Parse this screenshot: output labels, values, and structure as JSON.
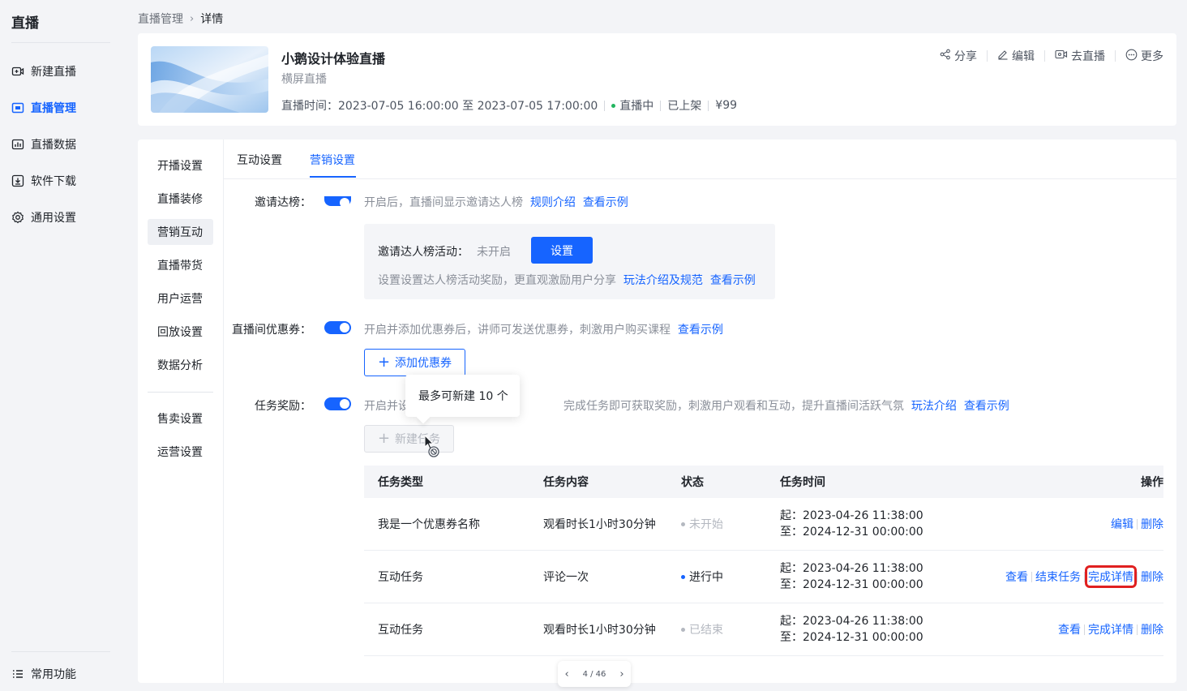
{
  "sidebar": {
    "brand": "直播",
    "items": [
      {
        "label": "新建直播",
        "icon": "video-add-icon"
      },
      {
        "label": "直播管理",
        "icon": "live-manage-icon"
      },
      {
        "label": "直播数据",
        "icon": "data-chart-icon"
      },
      {
        "label": "软件下载",
        "icon": "download-icon"
      },
      {
        "label": "通用设置",
        "icon": "gear-icon"
      }
    ],
    "bottom": {
      "label": "常用功能",
      "icon": "menu-list-icon"
    }
  },
  "breadcrumb": {
    "parent": "直播管理",
    "current": "详情"
  },
  "header": {
    "title": "小鹅设计体验直播",
    "subtitle": "横屏直播",
    "time_label": "直播时间：2023-07-05 16:00:00 至 2023-07-05 17:00:00",
    "status": "直播中",
    "shelf": "已上架",
    "price": "¥99",
    "actions": {
      "share": "分享",
      "edit": "编辑",
      "go_live": "去直播",
      "more": "更多"
    }
  },
  "subnav": {
    "items": [
      "开播设置",
      "直播装修",
      "营销互动",
      "直播带货",
      "用户运营",
      "回放设置",
      "数据分析"
    ],
    "items2": [
      "售卖设置",
      "运营设置"
    ]
  },
  "tabs": [
    "互动设置",
    "营销设置"
  ],
  "invite": {
    "label": "邀请达榜：",
    "desc": "开启后，直播间显示邀请达人榜",
    "link1": "规则介绍",
    "link2": "查看示例",
    "box_label": "邀请达人榜活动：",
    "box_status": "未开启",
    "box_button": "设置",
    "box_desc": "设置设置达人榜活动奖励，更直观激励用户分享",
    "box_link1": "玩法介绍及规范",
    "box_link2": "查看示例"
  },
  "coupon": {
    "label": "直播间优惠券：",
    "desc": "开启并添加优惠券后，讲师可发送优惠券，刺激用户购买课程",
    "link": "查看示例",
    "add_button": "添加优惠券"
  },
  "task": {
    "label": "任务奖励：",
    "desc_prefix": "开启并设",
    "desc_suffix": "完成任务即可获取奖励，刺激用户观看和互动，提升直播间活跃气氛",
    "link1": "玩法介绍",
    "link2": "查看示例",
    "new_button": "新建任务",
    "tooltip": "最多可新建 10 个"
  },
  "table": {
    "headers": [
      "任务类型",
      "任务内容",
      "状态",
      "任务时间",
      "操作"
    ],
    "rows": [
      {
        "type": "我是一个优惠券名称",
        "content": "观看时长1小时30分钟",
        "status": "未开始",
        "status_color": "#b4b8c0",
        "start": "起：2023-04-26 11:38:00",
        "end": "至：2024-12-31 00:00:00",
        "ops": [
          "编辑",
          "删除"
        ]
      },
      {
        "type": "互动任务",
        "content": "评论一次",
        "status": "进行中",
        "status_color": "#1664ff",
        "start": "起：2023-04-26 11:38:00",
        "end": "至：2024-12-31 00:00:00",
        "ops": [
          "查看",
          "结束任务",
          "完成详情",
          "删除"
        ]
      },
      {
        "type": "互动任务",
        "content": "观看时长1小时30分钟",
        "status": "已结束",
        "status_color": "#b4b8c0",
        "start": "起：2023-04-26 11:38:00",
        "end": "至：2024-12-31 00:00:00",
        "ops": [
          "查看",
          "完成详情",
          "删除"
        ]
      }
    ]
  },
  "pager": {
    "label": "4 / 46"
  }
}
